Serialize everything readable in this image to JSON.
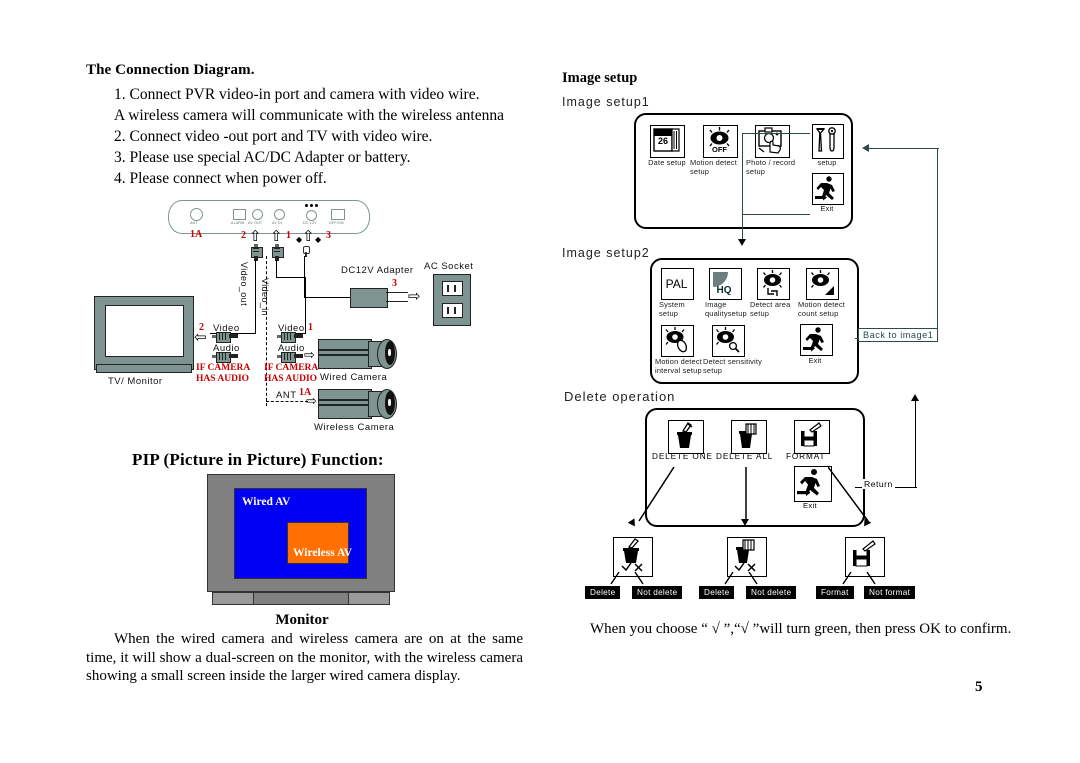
{
  "page": {
    "number": "5"
  },
  "left": {
    "heading": "The Connection Diagram.",
    "steps": [
      "1. Connect PVR video-in port and camera with video wire.",
      "A wireless camera will communicate with the wireless antenna",
      "2. Connect video -out port and TV with video wire.",
      "3. Please use special AC/DC Adapter or battery.",
      "4. Please connect when power off."
    ],
    "diagram": {
      "pvr_ports": [
        "ANT",
        "ALARM",
        "AV OUT",
        "AV IN",
        "DC 12V",
        "OFF/ON"
      ],
      "markers": {
        "ant": "1A",
        "av_out": "2",
        "av_in": "1",
        "dc": "3",
        "power": "3"
      },
      "video_out_label": "Video_out",
      "video_in_label": "Video_in",
      "adapter_label": "DC12V  Adapter",
      "ac_socket_label": "AC Socket",
      "tv_label": "TV/ Monitor",
      "tv_video": "Video",
      "tv_audio": "Audio",
      "cam_video": "Video",
      "cam_audio": "Audio",
      "if_camera_left": "IF CAMERA",
      "has_audio_left": "HAS AUDIO",
      "if_camera_right": "IF CAMERA",
      "has_audio_right": "HAS AUDIO",
      "wired_camera": "Wired  Camera",
      "wireless_camera": "Wireless  Camera",
      "ant_label": "ANT",
      "ant_marker": "1A"
    },
    "pip": {
      "title": "PIP (Picture in Picture) Function:",
      "wired_av": "Wired AV",
      "wireless_av": "Wireless AV",
      "caption": "Monitor",
      "paragraph": "When the wired camera and wireless camera are on at the same time, it will show a dual-screen on the monitor, with the wireless camera showing a small screen inside the larger wired camera display.",
      "colors": {
        "wired": "#0000f2",
        "wireless": "#ff7000",
        "bezel": "#808080"
      }
    }
  },
  "right": {
    "heading": "Image setup",
    "setup1": {
      "title": "Image  setup1",
      "items": [
        {
          "icon": "calendar-icon",
          "label": "Date  setup",
          "value": "26"
        },
        {
          "icon": "motion-detect-icon",
          "label": "Motion  detect\nsetup",
          "value": "OFF"
        },
        {
          "icon": "photo-record-icon",
          "label": "Photo / record\nsetup"
        },
        {
          "icon": "tools-icon",
          "label": "setup"
        },
        {
          "icon": "exit-running-man-icon",
          "label": "Exit"
        }
      ]
    },
    "setup2": {
      "title": "Image  setup2",
      "items": [
        {
          "icon": "pal-icon",
          "label": "System\nsetup",
          "value": "PAL"
        },
        {
          "icon": "image-quality-icon",
          "label": "Image\nqualitysetup",
          "value": "HQ"
        },
        {
          "icon": "detect-area-icon",
          "label": "Detect area\nsetup"
        },
        {
          "icon": "motion-count-icon",
          "label": "Motion  detect\ncount  setup"
        },
        {
          "icon": "motion-interval-icon",
          "label": "Motion  detect\ninterval  setup"
        },
        {
          "icon": "detect-sensitivity-icon",
          "label": "Detect  sensitivity\nsetup"
        },
        {
          "icon": "exit-running-man-icon",
          "label": "Exit"
        }
      ],
      "back_label": "Back  to  image1"
    },
    "delete": {
      "title": "Delete operation",
      "items": [
        {
          "icon": "delete-one-icon",
          "label": "DELETE  ONE"
        },
        {
          "icon": "delete-all-icon",
          "label": "DELETE  ALL"
        },
        {
          "icon": "format-icon",
          "label": "FORMAT"
        },
        {
          "icon": "exit-running-man-icon",
          "label": "Exit"
        }
      ],
      "return_label": "Return",
      "confirms": [
        {
          "icon": "delete-one-confirm-icon",
          "yes": "Delete",
          "no": "Not delete"
        },
        {
          "icon": "delete-all-confirm-icon",
          "yes": "Delete",
          "no": "Not delete"
        },
        {
          "icon": "format-confirm-icon",
          "yes": "Format",
          "no": "Not format"
        }
      ]
    },
    "footnote": "When you choose “ √ ”,“√ ”will turn green, then press OK to confirm."
  }
}
